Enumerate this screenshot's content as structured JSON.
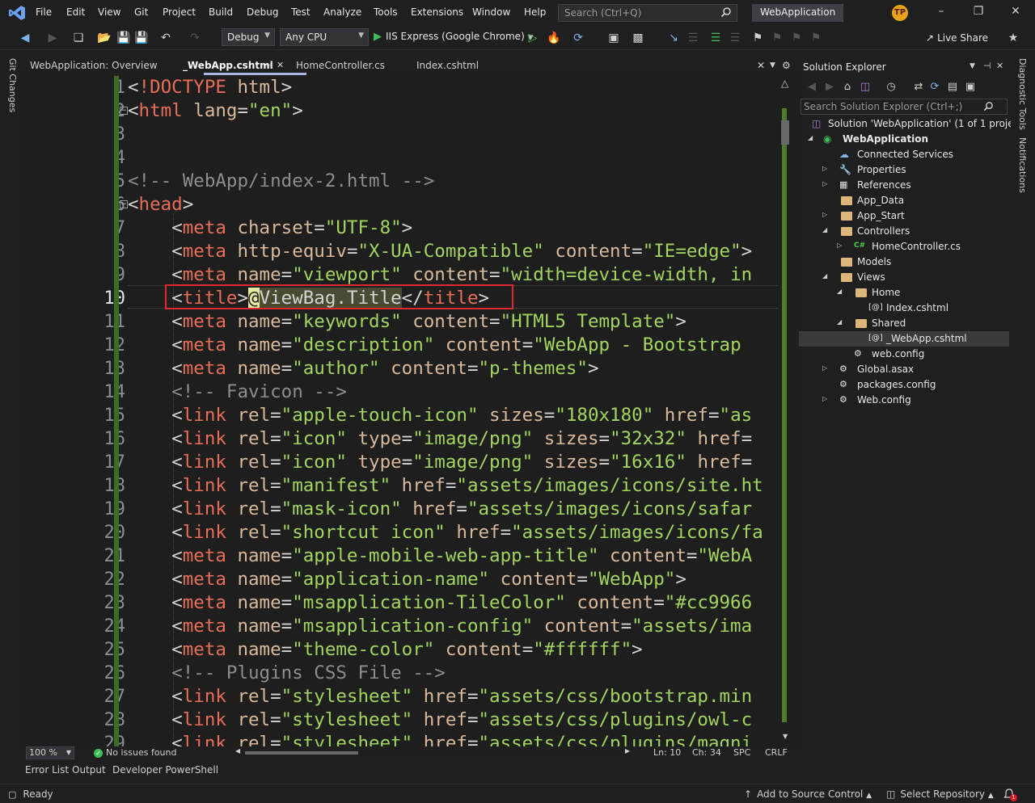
{
  "menubar": {
    "items": [
      "File",
      "Edit",
      "View",
      "Git",
      "Project",
      "Build",
      "Debug",
      "Test",
      "Analyze",
      "Tools",
      "Extensions",
      "Window",
      "Help"
    ],
    "search_placeholder": "Search (Ctrl+Q)",
    "app_title": "WebApplication",
    "user_initials": "TP"
  },
  "toolbar": {
    "config": "Debug",
    "platform": "Any CPU",
    "run_label": "IIS Express (Google Chrome)",
    "live_share": "Live Share"
  },
  "left_strip": {
    "git_changes": "Git Changes"
  },
  "right_strip": {
    "diagnostic_tools": "Diagnostic Tools",
    "notifications": "Notifications"
  },
  "tabs": {
    "overview": "WebApplication: Overview",
    "active": "_WebApp.cshtml",
    "home_controller": "HomeController.cs",
    "index": "Index.cshtml"
  },
  "editor": {
    "current_line": 10,
    "line_numbers": [
      "1",
      "2",
      "3",
      "4",
      "5",
      "6",
      "7",
      "8",
      "9",
      "10",
      "11",
      "12",
      "13",
      "14",
      "15",
      "16",
      "17",
      "18",
      "19",
      "20",
      "21",
      "22",
      "23",
      "24",
      "25",
      "26",
      "27",
      "28",
      "29"
    ]
  },
  "editor_footer": {
    "zoom": "100 %",
    "issues": "No issues found",
    "line": "Ln: 10",
    "col": "Ch: 34",
    "spc": "SPC",
    "crlf": "CRLF"
  },
  "tool_tabs": [
    "Error List",
    "Output",
    "Developer PowerShell"
  ],
  "status": {
    "ready": "Ready",
    "source_control": "Add to Source Control",
    "select_repo": "Select Repository",
    "notification_count": "1"
  },
  "solution_explorer": {
    "title": "Solution Explorer",
    "search_placeholder": "Search Solution Explorer (Ctrl+;)",
    "nodes": [
      {
        "label": "Solution 'WebApplication' (1 of 1 project)"
      },
      {
        "label": "WebApplication"
      },
      {
        "label": "Connected Services"
      },
      {
        "label": "Properties"
      },
      {
        "label": "References"
      },
      {
        "label": "App_Data"
      },
      {
        "label": "App_Start"
      },
      {
        "label": "Controllers"
      },
      {
        "label": "HomeController.cs"
      },
      {
        "label": "Models"
      },
      {
        "label": "Views"
      },
      {
        "label": "Home"
      },
      {
        "label": "Index.cshtml"
      },
      {
        "label": "Shared"
      },
      {
        "label": "_WebApp.cshtml"
      },
      {
        "label": "web.config"
      },
      {
        "label": "Global.asax"
      },
      {
        "label": "packages.config"
      },
      {
        "label": "Web.config"
      }
    ]
  },
  "colors": {
    "tag": "#e86e56",
    "attr": "#d9b99a",
    "value": "#a2d55e",
    "comment": "#8d8d8d",
    "highlight_box": "#e0282e",
    "change_bar": "#3d6b2b"
  }
}
